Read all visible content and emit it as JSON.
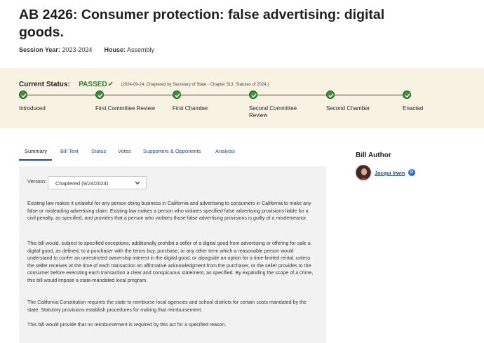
{
  "bill": {
    "title": "AB 2426: Consumer protection: false advertising: digital goods.",
    "session_year_label": "Session Year:",
    "session_year": "2023-2024",
    "house_label": "House:",
    "house": "Assembly"
  },
  "status": {
    "label": "Current Status:",
    "value": "PASSED",
    "detail": "(2024-09-24: Chaptered by Secretary of State - Chapter 513, Statutes of 2024.)",
    "status_color": "#2e7d32",
    "steps": [
      {
        "label": "Introduced"
      },
      {
        "label": "First Committee Review"
      },
      {
        "label": "First Chamber"
      },
      {
        "label": "Second Committee Review"
      },
      {
        "label": "Second Chamber"
      },
      {
        "label": "Enacted"
      }
    ]
  },
  "tabs": [
    {
      "label": "Summary"
    },
    {
      "label": "Bill Text"
    },
    {
      "label": "Status"
    },
    {
      "label": "Votes"
    },
    {
      "label": "Supporters & Opponents"
    },
    {
      "label": "Analysis"
    }
  ],
  "summary": {
    "version_label": "Version:",
    "version_value": "Chaptered (9/24/2024)",
    "paragraphs": [
      "Existing law makes it unlawful for any person doing business in California and advertising to consumers in California to make any false or misleading advertising claim. Existing law makes a person who violates specified false advertising provisions liable for a civil penalty, as specified, and provides that a person who violates those false advertising provisions is guilty of a misdemeanor.",
      "This bill would, subject to specified exceptions, additionally prohibit a seller of a digital good from advertising or offering for sale a digital good, as defined, to a purchaser with the terms buy, purchase, or any other term which a reasonable person would understand to confer an unrestricted ownership interest in the digital good, or alongside an option for a time-limited rental, unless the seller receives at the time of each transaction an affirmative acknowledgment from the purchaser, or the seller provides to the consumer before executing each transaction a clear and conspicuous statement, as specified. By expanding the scope of a crime, this bill would impose a state-mandated local program.",
      "The California Constitution requires the state to reimburse local agencies and school districts for certain costs mandated by the state. Statutory provisions establish procedures for making that reimbursement.",
      "This bill would provide that no reimbursement is required by this act for a specified reason."
    ]
  },
  "author": {
    "heading": "Bill Author",
    "name": "Jacqui Irwin",
    "party": "D",
    "party_color": "#2b6cd6"
  },
  "colors": {
    "accent": "#1a4d8f",
    "status_band": "#f7f2e1",
    "step_complete": "#3f8f3f"
  },
  "icons": {
    "status_check": "check-icon",
    "step_marker": "check-circle-icon",
    "select_toggle": "chevron-down-icon"
  }
}
